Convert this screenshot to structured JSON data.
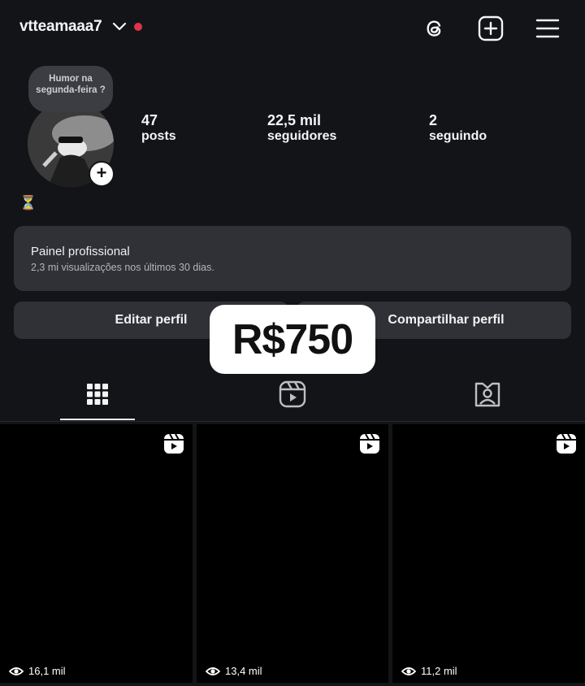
{
  "header": {
    "username": "vtteamaaa7",
    "status_dot_color": "#e0334a",
    "icons": [
      "threads-icon",
      "add-post-icon",
      "menu-icon"
    ]
  },
  "profile": {
    "note_text": "Humor na segunda-feira ?",
    "emoji": "⏳",
    "stats": [
      {
        "value": "47",
        "label": "posts"
      },
      {
        "value": "22,5 mil",
        "label": "seguidores"
      },
      {
        "value": "2",
        "label": "seguindo"
      }
    ]
  },
  "dashboard": {
    "title": "Painel profissional",
    "subtitle": "2,3 mi visualizações nos últimos 30 dias."
  },
  "actions": {
    "edit_label": "Editar perfil",
    "share_label": "Compartilhar perfil"
  },
  "overlay": {
    "price": "R$750"
  },
  "tabs": [
    "posts-grid-icon",
    "reels-icon",
    "tagged-icon"
  ],
  "grid": [
    {
      "views": "16,1 mil"
    },
    {
      "views": "13,4 mil"
    },
    {
      "views": "11,2 mil"
    }
  ]
}
